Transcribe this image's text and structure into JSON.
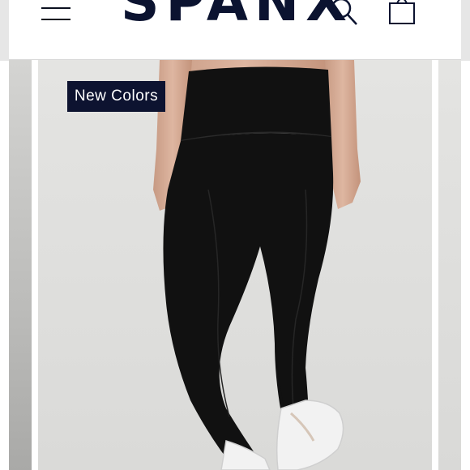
{
  "header": {
    "logo_text": "SPANX",
    "menu_icon": "hamburger-menu-icon",
    "search_icon": "search-icon",
    "cart_icon": "shopping-bag-icon"
  },
  "product_image": {
    "badge_label": "New Colors",
    "description_icon": "black-high-waist-leggings-photo"
  },
  "colors": {
    "brand_navy": "#0d1330",
    "legging_black": "#111111",
    "background": "#e2e2e0"
  }
}
